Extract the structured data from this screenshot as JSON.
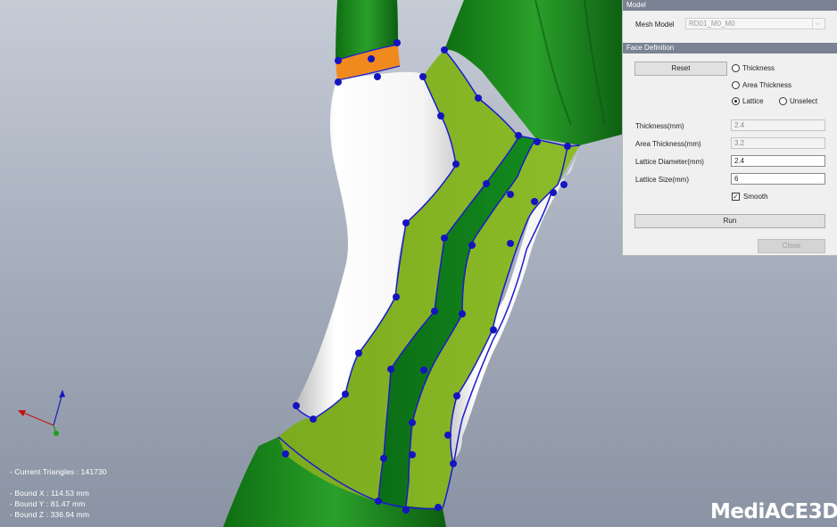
{
  "panel": {
    "model_header": "Model",
    "mesh_model_label": "Mesh Model",
    "mesh_model_value": "RD01_M0_M0",
    "face_header": "Face Definition",
    "reset_label": "Reset",
    "mode_options": {
      "thickness": "Thickness",
      "area_thickness": "Area Thickness",
      "lattice": "Lattice",
      "unselect": "Unselect"
    },
    "selected_mode": "lattice",
    "fields": {
      "thickness_label": "Thickness(mm)",
      "thickness_value": "2.4",
      "area_thickness_label": "Area Thickness(mm)",
      "area_thickness_value": "3.2",
      "lattice_diameter_label": "Lattice Diameter(mm)",
      "lattice_diameter_value": "2.4",
      "lattice_size_label": "Lattice Size(mm)",
      "lattice_size_value": "6"
    },
    "smooth_label": "Smooth",
    "smooth_checked": true,
    "run_label": "Run",
    "close_label": "Close"
  },
  "info": {
    "triangles": "- Current Triangles : 141730",
    "bound_x": "- Bound X : 114.53 mm",
    "bound_y": "- Bound Y : 81.47 mm",
    "bound_z": "- Bound Z : 336.94 mm"
  },
  "logo": {
    "text_a": "Medi",
    "text_b": "ACE3D"
  },
  "colors": {
    "model_green": "#1f8a1f",
    "light_green": "#85b522",
    "dark_green": "#0f7a1a",
    "orange": "#f08a1e",
    "control_point": "#1717c4",
    "panel_header": "#7a8293"
  },
  "icons": {
    "axis": "axis-triad-icon",
    "chevron": "chevron-down-icon"
  }
}
